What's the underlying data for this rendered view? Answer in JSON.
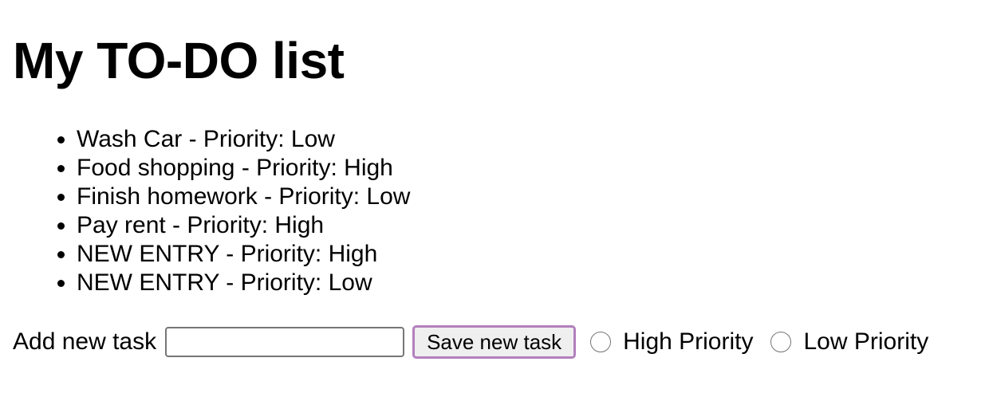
{
  "page": {
    "title": "My TO-DO list"
  },
  "tasks": [
    {
      "text": "Wash Car - Priority: Low"
    },
    {
      "text": "Food shopping - Priority: High"
    },
    {
      "text": "Finish homework - Priority: Low"
    },
    {
      "text": "Pay rent - Priority: High"
    },
    {
      "text": "NEW ENTRY - Priority: High"
    },
    {
      "text": "NEW ENTRY - Priority: Low"
    }
  ],
  "form": {
    "add_label": "Add new task",
    "input_value": "",
    "input_placeholder": "",
    "save_label": "Save new task",
    "high_priority_label": "High Priority",
    "low_priority_label": "Low Priority",
    "high_checked": false,
    "low_checked": false
  },
  "colors": {
    "focus_outline": "#b27fbd",
    "button_background": "#efefef",
    "input_border": "#767676"
  }
}
